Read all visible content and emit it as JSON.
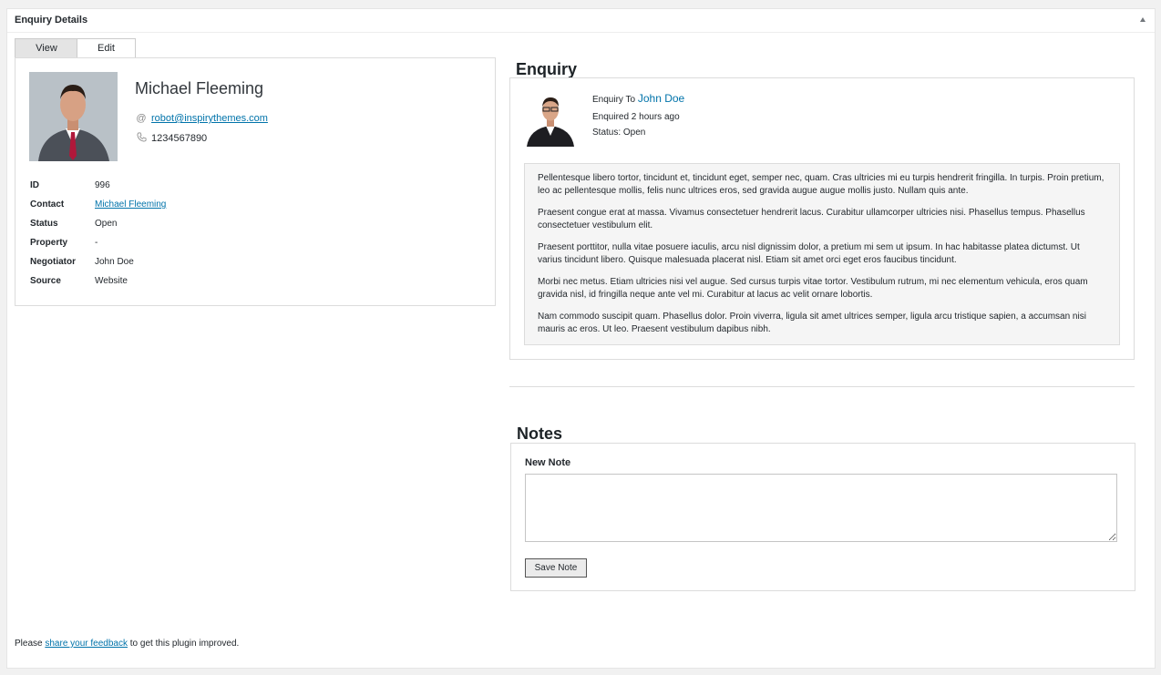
{
  "postbox": {
    "title": "Enquiry Details"
  },
  "tabs": {
    "view": "View",
    "edit": "Edit"
  },
  "contact": {
    "name": "Michael Fleeming",
    "email": "robot@inspirythemes.com",
    "phone": "1234567890",
    "email_icon": "at-icon",
    "phone_icon": "phone-icon"
  },
  "details": [
    {
      "label": "ID",
      "value": "996"
    },
    {
      "label": "Contact",
      "value": "Michael Fleeming"
    },
    {
      "label": "Status",
      "value": "Open"
    },
    {
      "label": "Property",
      "value": "-"
    },
    {
      "label": "Negotiator",
      "value": "John Doe"
    },
    {
      "label": "Source",
      "value": "Website"
    }
  ],
  "enquiry": {
    "title": "Enquiry",
    "to_prefix": "Enquiry To",
    "to_name": "John Doe",
    "enquired": "Enquired 2 hours ago",
    "status": "Status: Open",
    "message": [
      "Pellentesque libero tortor, tincidunt et, tincidunt eget, semper nec, quam. Cras ultricies mi eu turpis hendrerit fringilla. In turpis. Proin pretium, leo ac pellentesque mollis, felis nunc ultrices eros, sed gravida augue augue mollis justo. Nullam quis ante.",
      "Praesent congue erat at massa. Vivamus consectetuer hendrerit lacus. Curabitur ullamcorper ultricies nisi. Phasellus tempus. Phasellus consectetuer vestibulum elit.",
      "Praesent porttitor, nulla vitae posuere iaculis, arcu nisl dignissim dolor, a pretium mi sem ut ipsum. In hac habitasse platea dictumst. Ut varius tincidunt libero. Quisque malesuada placerat nisl. Etiam sit amet orci eget eros faucibus tincidunt.",
      "Morbi nec metus. Etiam ultricies nisi vel augue. Sed cursus turpis vitae tortor. Vestibulum rutrum, mi nec elementum vehicula, eros quam gravida nisl, id fringilla neque ante vel mi. Curabitur at lacus ac velit ornare lobortis.",
      "Nam commodo suscipit quam. Phasellus dolor. Proin viverra, ligula sit amet ultrices semper, ligula arcu tristique sapien, a accumsan nisi mauris ac eros. Ut leo. Praesent vestibulum dapibus nibh."
    ]
  },
  "notes": {
    "title": "Notes",
    "new_note_label": "New Note",
    "textarea_value": "",
    "save_label": "Save Note"
  },
  "footer": {
    "prefix": "Please",
    "link": "share your feedback",
    "suffix": "to get this plugin improved."
  },
  "colors": {
    "link": "#0073aa",
    "panel_border": "#dcdcdc",
    "message_bg": "#f5f5f5"
  }
}
